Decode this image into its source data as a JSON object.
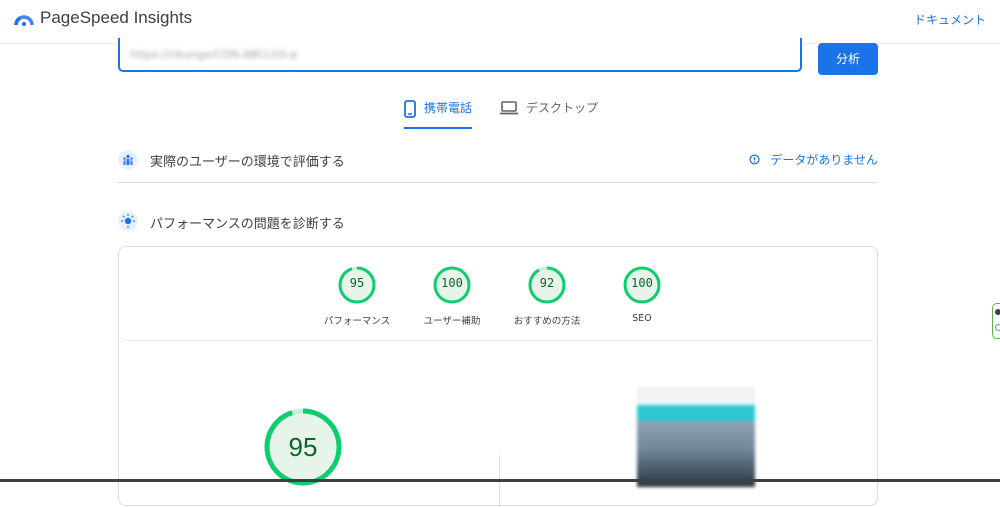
{
  "header": {
    "app_title": "PageSpeed Insights",
    "docs_label": "ドキュメント"
  },
  "url_bar": {
    "value": "https://rikunge/CON.ABCLGS-p"
  },
  "analyze_label": "分析",
  "device_tabs": [
    {
      "label": "携帯電話",
      "selected": true,
      "icon": "smartphone-icon"
    },
    {
      "label": "デスクトップ",
      "selected": false,
      "icon": "laptop-icon"
    }
  ],
  "field_data": {
    "title": "実際のユーザーの環境で評価する",
    "no_data_label": "データがありません"
  },
  "lab_data": {
    "title": "パフォーマンスの問題を診断する"
  },
  "scores": [
    {
      "value": "95",
      "label": "パフォーマンス"
    },
    {
      "value": "100",
      "label": "ユーザー補助"
    },
    {
      "value": "92",
      "label": "おすすめの方法"
    },
    {
      "value": "100",
      "label": "SEO"
    }
  ],
  "performance_score": "95",
  "colors": {
    "accent": "#1a73e8",
    "pass_green": "#0cce6b",
    "pass_text": "#0d652d"
  }
}
